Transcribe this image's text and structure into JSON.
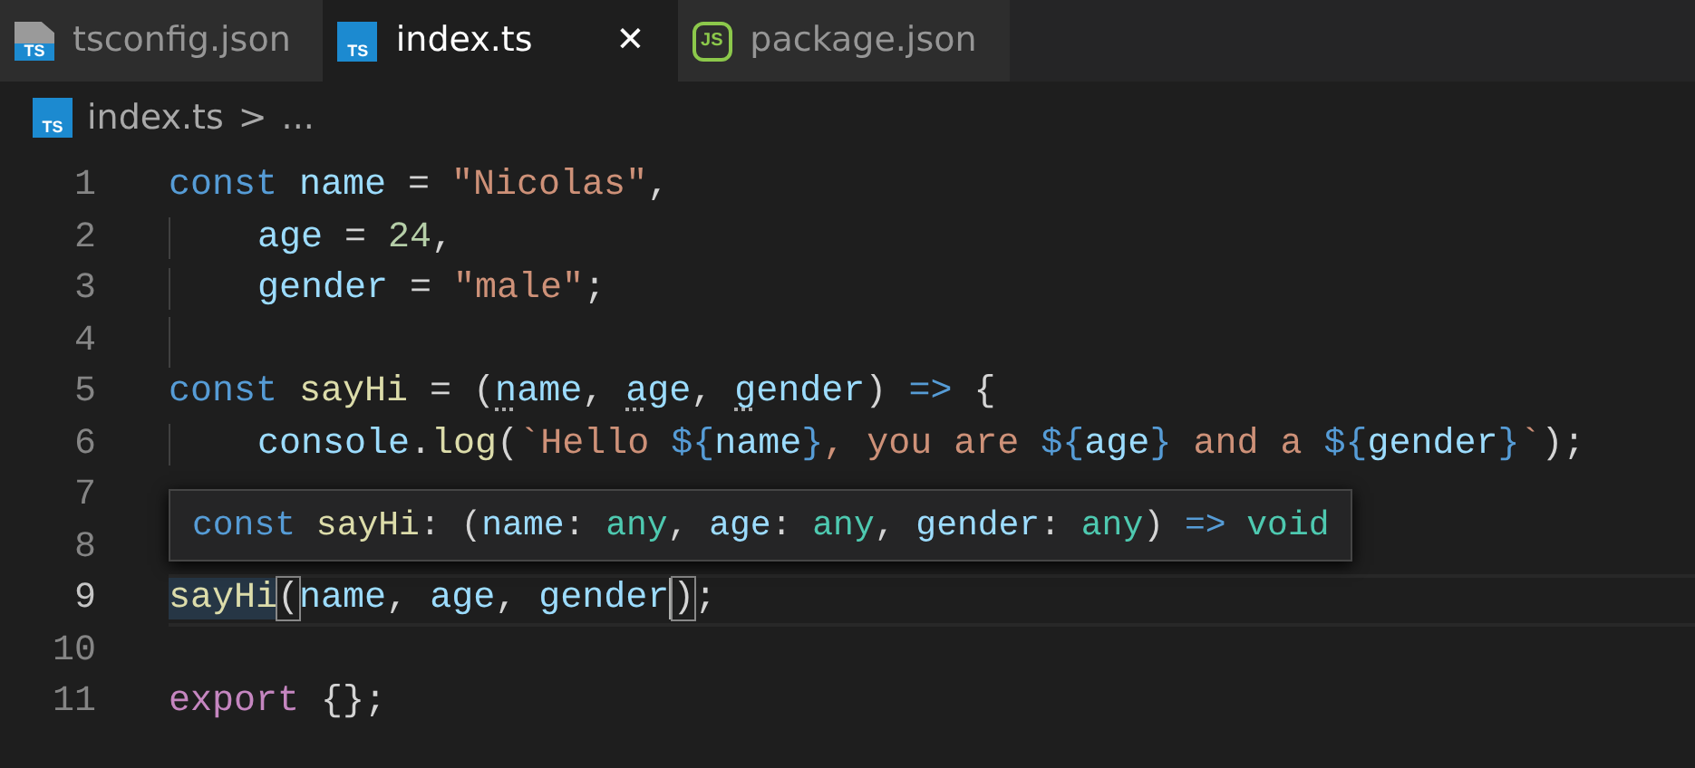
{
  "tabs": [
    {
      "label": "tsconfig.json",
      "icon": {
        "kind": "ts-config",
        "label": "TS"
      },
      "selected": false
    },
    {
      "label": "index.ts",
      "icon": {
        "kind": "ts",
        "label": "TS"
      },
      "selected": true,
      "close": "✕"
    },
    {
      "label": "package.json",
      "icon": {
        "kind": "node",
        "label": "JS"
      },
      "selected": false
    }
  ],
  "breadcrumb": {
    "icon": {
      "kind": "ts",
      "label": "TS"
    },
    "file": "index.ts",
    "separator": ">",
    "more": "..."
  },
  "lines": [
    {
      "number": "1",
      "tokens": [
        {
          "t": "const ",
          "kind": "keyword"
        },
        {
          "t": "name",
          "kind": "variable"
        },
        {
          "t": " = ",
          "kind": "punct"
        },
        {
          "t": "\"Nicolas\"",
          "kind": "string"
        },
        {
          "t": ",",
          "kind": "punct"
        }
      ]
    },
    {
      "number": "2",
      "indent_guide": true,
      "tokens": [
        {
          "t": "age",
          "kind": "variable"
        },
        {
          "t": " = ",
          "kind": "punct"
        },
        {
          "t": "24",
          "kind": "number"
        },
        {
          "t": ",",
          "kind": "punct"
        }
      ]
    },
    {
      "number": "3",
      "indent_guide": true,
      "tokens": [
        {
          "t": "gender",
          "kind": "variable"
        },
        {
          "t": " = ",
          "kind": "punct"
        },
        {
          "t": "\"male\"",
          "kind": "string"
        },
        {
          "t": ";",
          "kind": "punct"
        }
      ]
    },
    {
      "number": "4",
      "indent_guide": true
    },
    {
      "number": "5",
      "tokens": [
        {
          "t": "const ",
          "kind": "keyword"
        },
        {
          "t": "sayHi",
          "kind": "function"
        },
        {
          "t": " = (",
          "kind": "punct"
        },
        {
          "t": "n",
          "kind": "variable",
          "hint": true
        },
        {
          "t": "ame",
          "kind": "variable"
        },
        {
          "t": ", ",
          "kind": "punct"
        },
        {
          "t": "a",
          "kind": "variable",
          "hint": true
        },
        {
          "t": "ge",
          "kind": "variable"
        },
        {
          "t": ", ",
          "kind": "punct"
        },
        {
          "t": "g",
          "kind": "variable",
          "hint": true
        },
        {
          "t": "ender",
          "kind": "variable"
        },
        {
          "t": ") ",
          "kind": "punct"
        },
        {
          "t": "=>",
          "kind": "keyword"
        },
        {
          "t": " {",
          "kind": "punct"
        }
      ]
    },
    {
      "number": "6",
      "indent_guide": true,
      "tokens": [
        {
          "t": "console",
          "kind": "variable"
        },
        {
          "t": ".",
          "kind": "punct"
        },
        {
          "t": "log",
          "kind": "function"
        },
        {
          "t": "(",
          "kind": "punct"
        },
        {
          "t": "`Hello ",
          "kind": "string"
        },
        {
          "t": "${",
          "kind": "keyword"
        },
        {
          "t": "name",
          "kind": "variable"
        },
        {
          "t": "}",
          "kind": "keyword"
        },
        {
          "t": ", you are ",
          "kind": "string"
        },
        {
          "t": "${",
          "kind": "keyword"
        },
        {
          "t": "age",
          "kind": "variable"
        },
        {
          "t": "}",
          "kind": "keyword"
        },
        {
          "t": " and a ",
          "kind": "string"
        },
        {
          "t": "${",
          "kind": "keyword"
        },
        {
          "t": "gender",
          "kind": "variable"
        },
        {
          "t": "}",
          "kind": "keyword"
        },
        {
          "t": "`",
          "kind": "string"
        },
        {
          "t": ");",
          "kind": "punct"
        }
      ]
    },
    {
      "number": "7"
    },
    {
      "number": "8"
    },
    {
      "number": "9",
      "current": true,
      "tokens": [
        {
          "t": "sayHi",
          "kind": "function",
          "highlight": true
        },
        {
          "t": "(",
          "kind": "punct",
          "bracket_match": true
        },
        {
          "t": "name",
          "kind": "variable"
        },
        {
          "t": ", ",
          "kind": "punct"
        },
        {
          "t": "age",
          "kind": "variable"
        },
        {
          "t": ", ",
          "kind": "punct"
        },
        {
          "t": "gender",
          "kind": "variable",
          "cursor": true
        },
        {
          "t": ")",
          "kind": "punct",
          "bracket_match": true
        },
        {
          "t": ";",
          "kind": "punct"
        }
      ]
    },
    {
      "number": "10"
    },
    {
      "number": "11",
      "tokens": [
        {
          "t": "export",
          "kind": "control"
        },
        {
          "t": " {};",
          "kind": "punct"
        }
      ]
    }
  ],
  "hover": {
    "tokens": [
      {
        "t": "const ",
        "kind": "keyword"
      },
      {
        "t": "sayHi",
        "kind": "function"
      },
      {
        "t": ": (",
        "kind": "punct"
      },
      {
        "t": "name",
        "kind": "variable"
      },
      {
        "t": ": ",
        "kind": "punct"
      },
      {
        "t": "any",
        "kind": "type"
      },
      {
        "t": ", ",
        "kind": "punct"
      },
      {
        "t": "age",
        "kind": "variable"
      },
      {
        "t": ": ",
        "kind": "punct"
      },
      {
        "t": "any",
        "kind": "type"
      },
      {
        "t": ", ",
        "kind": "punct"
      },
      {
        "t": "gender",
        "kind": "variable"
      },
      {
        "t": ": ",
        "kind": "punct"
      },
      {
        "t": "any",
        "kind": "type"
      },
      {
        "t": ") ",
        "kind": "punct"
      },
      {
        "t": "=> ",
        "kind": "keyword"
      },
      {
        "t": "void",
        "kind": "type"
      }
    ]
  }
}
